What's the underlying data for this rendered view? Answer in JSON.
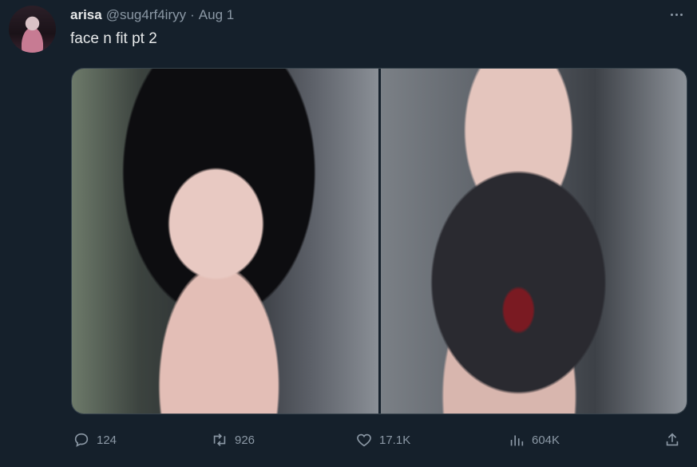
{
  "tweet": {
    "display_name": "arisa",
    "handle": "@sug4rf4iryy",
    "separator": "·",
    "date": "Aug 1",
    "text": "face n fit pt 2"
  },
  "media": {
    "count": 2
  },
  "actions": {
    "replies": "124",
    "retweets": "926",
    "likes": "17.1K",
    "views": "604K"
  },
  "icons": {
    "more": "more-icon",
    "reply": "reply-icon",
    "retweet": "retweet-icon",
    "like": "heart-icon",
    "views": "views-icon",
    "share": "share-icon"
  },
  "colors": {
    "background": "#15202b",
    "text_primary": "#e7e9ea",
    "text_secondary": "#8b98a5"
  }
}
